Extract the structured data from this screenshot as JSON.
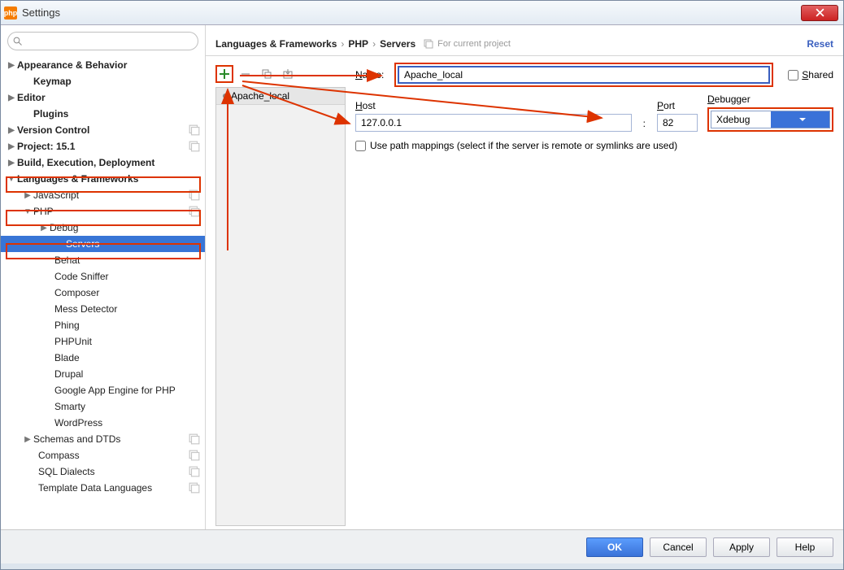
{
  "titlebar": {
    "title": "Settings"
  },
  "search": {
    "placeholder": ""
  },
  "tree": {
    "appearance": "Appearance & Behavior",
    "keymap": "Keymap",
    "editor": "Editor",
    "plugins": "Plugins",
    "vcs": "Version Control",
    "project": "Project: 15.1",
    "build": "Build, Execution, Deployment",
    "langfw": "Languages & Frameworks",
    "javascript": "JavaScript",
    "php": "PHP",
    "debug": "Debug",
    "servers": "Servers",
    "behat": "Behat",
    "codesniffer": "Code Sniffer",
    "composer": "Composer",
    "messdetector": "Mess Detector",
    "phing": "Phing",
    "phpunit": "PHPUnit",
    "blade": "Blade",
    "drupal": "Drupal",
    "gae": "Google App Engine for PHP",
    "smarty": "Smarty",
    "wordpress": "WordPress",
    "schemas": "Schemas and DTDs",
    "compass": "Compass",
    "sqldialects": "SQL Dialects",
    "templatedata": "Template Data Languages"
  },
  "breadcrumb": {
    "a": "Languages & Frameworks",
    "b": "PHP",
    "c": "Servers",
    "proj": "For current project",
    "reset": "Reset"
  },
  "serverlist": {
    "item0": "Apache_local"
  },
  "form": {
    "name_label": "Name:",
    "name_value": "Apache_local",
    "shared_label": "Shared",
    "host_label": "Host",
    "host_value": "127.0.0.1",
    "port_label": "Port",
    "port_value": "82",
    "debugger_label": "Debugger",
    "debugger_value": "Xdebug",
    "usepath_label": "Use path mappings (select if the server is remote or symlinks are used)"
  },
  "buttons": {
    "ok": "OK",
    "cancel": "Cancel",
    "apply": "Apply",
    "help": "Help"
  }
}
